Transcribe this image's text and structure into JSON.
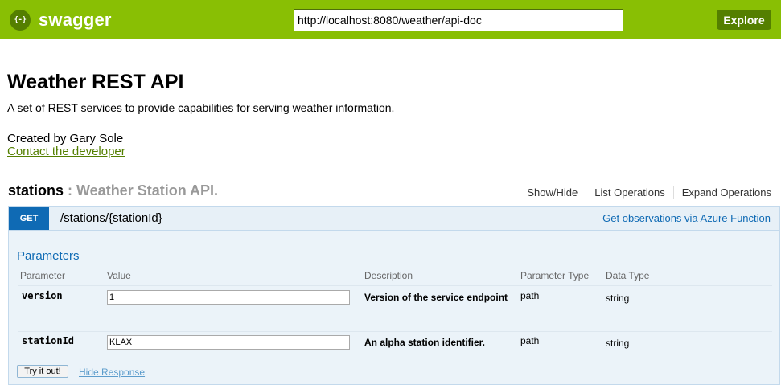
{
  "header": {
    "logo_glyph": "{-}",
    "brand": "swagger",
    "api_url": "http://localhost:8080/weather/api-doc",
    "explore_label": "Explore",
    "bar_color": "#89bf04"
  },
  "info": {
    "title": "Weather REST API",
    "description": "A set of REST services to provide capabilities for serving weather information.",
    "created_by": "Created by Gary Sole",
    "contact_link": "Contact the developer"
  },
  "resource": {
    "name": "stations",
    "separator_desc": " : Weather Station API.",
    "options": [
      "Show/Hide",
      "List Operations",
      "Expand Operations"
    ]
  },
  "operation": {
    "method": "GET",
    "path": "/stations/{stationId}",
    "summary": "Get observations via Azure Function",
    "method_color": "#0f6ab4",
    "parameters_title": "Parameters",
    "columns": [
      "Parameter",
      "Value",
      "Description",
      "Parameter Type",
      "Data Type"
    ],
    "params": [
      {
        "name": "version",
        "value": "1",
        "description": "Version of the service endpoint",
        "param_type": "path",
        "data_type": "string"
      },
      {
        "name": "stationId",
        "value": "KLAX",
        "description": "An alpha station identifier.",
        "param_type": "path",
        "data_type": "string"
      }
    ],
    "try_label": "Try it out!",
    "hide_response_label": "Hide Response"
  }
}
